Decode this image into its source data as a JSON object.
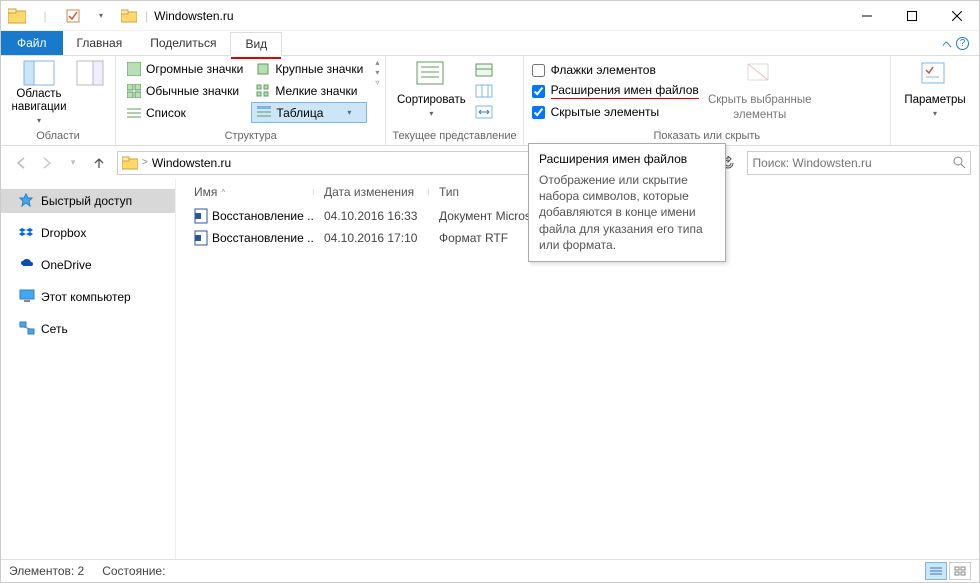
{
  "title": "Windowsten.ru",
  "tabs": {
    "file": "Файл",
    "home": "Главная",
    "share": "Поделиться",
    "view": "Вид"
  },
  "ribbon": {
    "nav_pane": "Область навигации",
    "group_panes": "Области",
    "icons": {
      "huge": "Огромные значки",
      "large": "Крупные значки",
      "normal": "Обычные значки",
      "small": "Мелкие значки",
      "list": "Список",
      "table": "Таблица"
    },
    "group_layout": "Структура",
    "sort": "Сортировать",
    "group_view": "Текущее представление",
    "check_items": "Флажки элементов",
    "check_ext": "Расширения имен файлов",
    "check_hidden": "Скрытые элементы",
    "hide_selected_1": "Скрыть выбранные",
    "hide_selected_2": "элементы",
    "group_show": "Показать или скрыть",
    "options": "Параметры"
  },
  "address": {
    "root_sep": ">",
    "part1": "Windowsten.ru",
    "search_placeholder": "Поиск: Windowsten.ru"
  },
  "sidebar": {
    "quick": "Быстрый доступ",
    "dropbox": "Dropbox",
    "onedrive": "OneDrive",
    "computer": "Этот компьютер",
    "network": "Сеть"
  },
  "columns": {
    "name": "Имя",
    "date": "Дата изменения",
    "type": "Тип"
  },
  "files": [
    {
      "name": "Восстановление ...",
      "date": "04.10.2016 16:33",
      "type": "Документ Micros..."
    },
    {
      "name": "Восстановление ...",
      "date": "04.10.2016 17:10",
      "type": "Формат RTF"
    }
  ],
  "tooltip": {
    "title": "Расширения имен файлов",
    "body": "Отображение или скрытие набора символов, которые добавляются в конце имени файла для указания его типа или формата."
  },
  "status": {
    "count": "Элементов: 2",
    "state": "Состояние:"
  }
}
